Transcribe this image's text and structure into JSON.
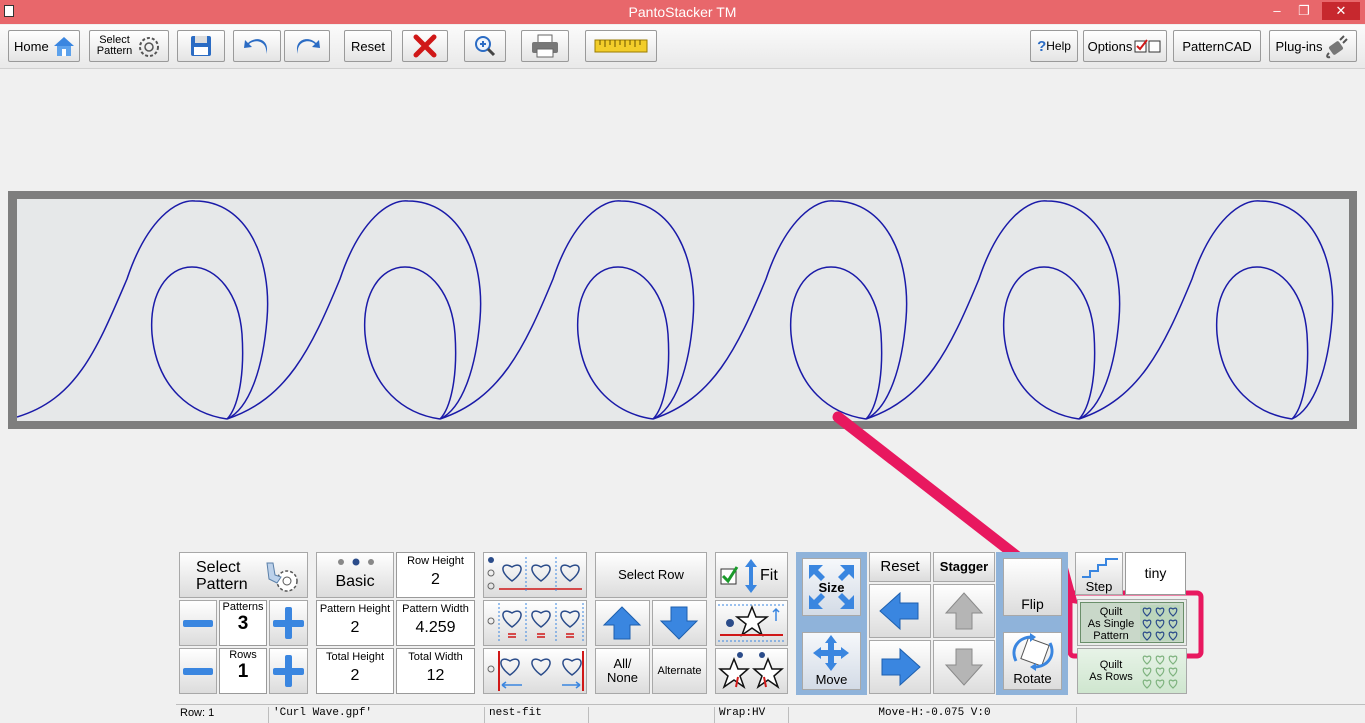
{
  "window": {
    "title": "PantoStacker TM",
    "controls": {
      "minimize": "–",
      "maximize": "❐",
      "close": "✕"
    }
  },
  "toolbar": {
    "home": "Home",
    "select_pattern_line1": "Select",
    "select_pattern_line2": "Pattern",
    "reset": "Reset",
    "help": "Help",
    "help_mark": "?",
    "options": "Options",
    "patterncad": "PatternCAD",
    "plugins": "Plug-ins"
  },
  "panel": {
    "select_pattern_line1": "Select",
    "select_pattern_line2": "Pattern",
    "patterns_label": "Patterns",
    "patterns_value": "3",
    "rows_label": "Rows",
    "rows_value": "1",
    "basic": "Basic",
    "row_height_label": "Row Height",
    "row_height_value": "2",
    "pattern_height_label": "Pattern Height",
    "pattern_height_value": "2",
    "pattern_width_label": "Pattern Width",
    "pattern_width_value": "4.259",
    "total_height_label": "Total Height",
    "total_height_value": "2",
    "total_width_label": "Total Width",
    "total_width_value": "12",
    "select_row": "Select Row",
    "all_none_line1": "All/",
    "all_none_line2": "None",
    "alternate": "Alternate",
    "fit": "Fit",
    "size": "Size",
    "move": "Move",
    "reset": "Reset",
    "stagger": "Stagger",
    "flip": "Flip",
    "rotate": "Rotate",
    "step": "Step",
    "step_value": "tiny",
    "quilt_single_line1": "Quilt",
    "quilt_single_line2": "As Single",
    "quilt_single_line3": "Pattern",
    "quilt_rows_line1": "Quilt",
    "quilt_rows_line2": "As Rows"
  },
  "status": {
    "row": "Row: 1",
    "file": "'Curl Wave.gpf'",
    "mode": "nest-fit",
    "blank": "",
    "wrap": "Wrap:HV",
    "move": "Move-H:-0.075 V:0"
  },
  "colors": {
    "titlebar": "#e8676b",
    "pattern_stroke": "#1a1aa8",
    "highlight": "#e8185f",
    "blue_arrow": "#3a86e0"
  }
}
